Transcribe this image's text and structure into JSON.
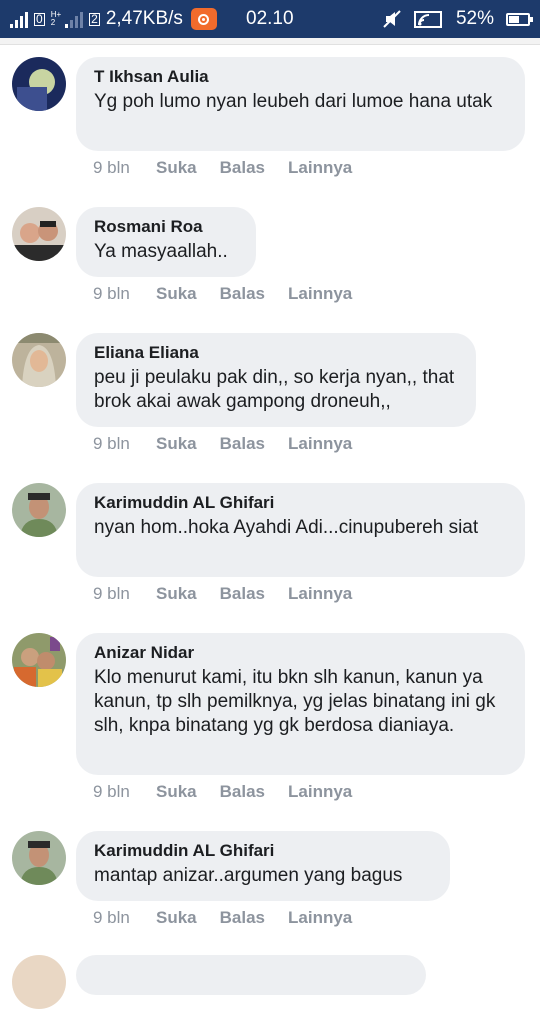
{
  "status_bar": {
    "net_speed": "2,47KB/s",
    "clock": "02.10",
    "battery_percent": "52%",
    "battery_level": 0.52,
    "network_tiny_top": "H+",
    "network_tiny_bottom": "2",
    "colors": {
      "bar": "#1d3a6b",
      "record": "#f26b2c"
    }
  },
  "action_labels": {
    "like": "Suka",
    "reply": "Balas",
    "more": "Lainnya"
  },
  "comments": [
    {
      "author": "T Ikhsan Aulia",
      "text": "Yg poh lumo nyan leubeh dari lumoe hana utak",
      "age": "9 bln"
    },
    {
      "author": "Rosmani Roa",
      "text": "Ya masyaallah..",
      "age": "9 bln"
    },
    {
      "author": "Eliana Eliana",
      "text": "peu ji peulaku pak din,, so kerja nyan,, that brok akai awak gampong droneuh,,",
      "age": "9 bln"
    },
    {
      "author": "Karimuddin AL Ghifari",
      "text": "nyan hom..hoka Ayahdi Adi...cinupubereh siat",
      "age": "9 bln"
    },
    {
      "author": "Anizar Nidar",
      "text": "Klo menurut kami, itu bkn slh kanun, kanun ya kanun, tp slh pemilknya, yg jelas binatang ini gk slh, knpa binatang yg gk berdosa dianiaya.",
      "age": "9 bln"
    },
    {
      "author": "Karimuddin AL Ghifari",
      "text": "mantap anizar..argumen yang bagus",
      "age": "9 bln"
    }
  ]
}
